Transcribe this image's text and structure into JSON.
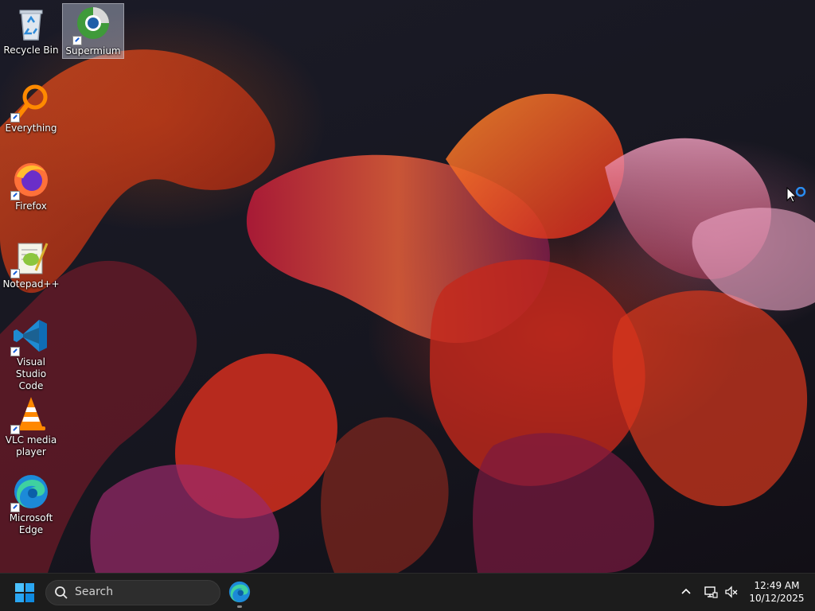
{
  "desktop": {
    "icons": [
      {
        "label": "Recycle Bin"
      },
      {
        "label": "Supermium"
      },
      {
        "label": "Everything"
      },
      {
        "label": "Firefox"
      },
      {
        "label": "Notepad++"
      },
      {
        "label": "Visual Studio Code"
      },
      {
        "label": "VLC media player"
      },
      {
        "label": "Microsoft Edge"
      }
    ],
    "selected_icon": "Supermium"
  },
  "taskbar": {
    "search_placeholder": "Search",
    "clock_time": "12:49 AM",
    "clock_date": "10/12/2025"
  },
  "colors": {
    "taskbar_bg": "#1c1c1c",
    "accent": "#0078d4"
  },
  "icon_names": [
    "recycle-bin-icon",
    "supermium-icon",
    "everything-icon",
    "firefox-icon",
    "notepadpp-icon",
    "vscode-icon",
    "vlc-icon",
    "edge-icon",
    "windows-start-icon",
    "search-icon",
    "chevron-up-icon",
    "network-icon",
    "volume-muted-icon"
  ]
}
